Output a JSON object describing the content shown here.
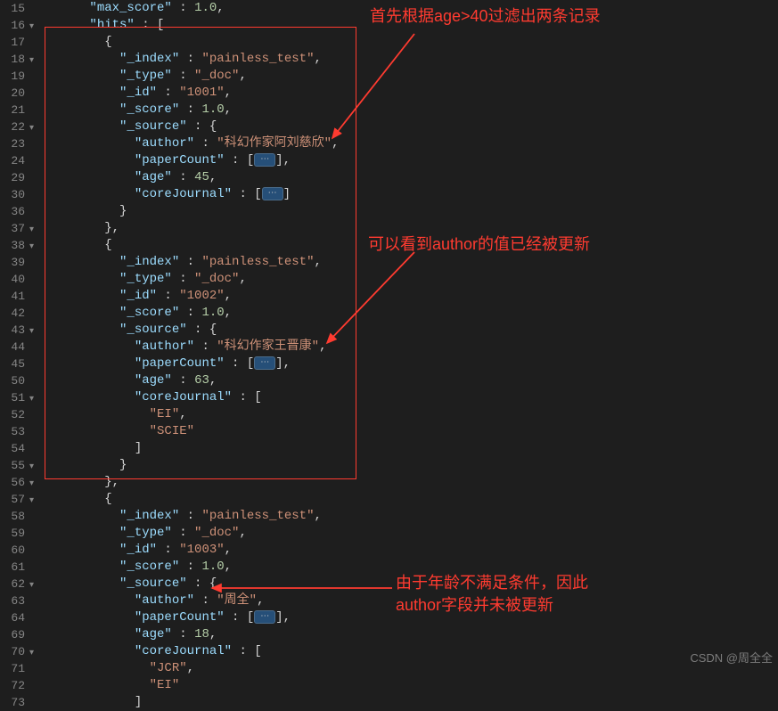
{
  "gutter": [
    "15",
    "16",
    "17",
    "18",
    "19",
    "20",
    "21",
    "22",
    "23",
    "24",
    "29",
    "30",
    "36",
    "37",
    "38",
    "39",
    "40",
    "41",
    "42",
    "43",
    "44",
    "45",
    "50",
    "51",
    "52",
    "53",
    "54",
    "55",
    "56",
    "57",
    "58",
    "59",
    "60",
    "61",
    "62",
    "63",
    "64",
    "69",
    "70",
    "71",
    "72",
    "73"
  ],
  "folds": [
    1,
    3,
    7,
    13,
    14,
    19,
    23,
    27,
    28,
    29,
    34,
    38
  ],
  "lines": {
    "l0": {
      "pre": "      ",
      "k": "\"max_score\"",
      "mid": " : ",
      "v": "1.0",
      "tail": ","
    },
    "l1": {
      "pre": "      ",
      "k": "\"hits\"",
      "mid": " : [",
      "v": "",
      "tail": ""
    },
    "l2": {
      "pre": "        {",
      "k": "",
      "mid": "",
      "v": "",
      "tail": ""
    },
    "l3": {
      "pre": "          ",
      "k": "\"_index\"",
      "mid": " : ",
      "v": "\"painless_test\"",
      "tail": ","
    },
    "l4": {
      "pre": "          ",
      "k": "\"_type\"",
      "mid": " : ",
      "v": "\"_doc\"",
      "tail": ","
    },
    "l5": {
      "pre": "          ",
      "k": "\"_id\"",
      "mid": " : ",
      "v": "\"1001\"",
      "tail": ","
    },
    "l6": {
      "pre": "          ",
      "k": "\"_score\"",
      "mid": " : ",
      "v": "1.0",
      "tail": ","
    },
    "l7": {
      "pre": "          ",
      "k": "\"_source\"",
      "mid": " : {",
      "v": "",
      "tail": ""
    },
    "l8": {
      "pre": "            ",
      "k": "\"author\"",
      "mid": " : ",
      "v": "\"科幻作家阿刘慈欣\"",
      "tail": ","
    },
    "l9": {
      "pre": "            ",
      "k": "\"paperCount\"",
      "mid": " : [",
      "v": "",
      "tail": "],",
      "badge": "⋯"
    },
    "l10": {
      "pre": "            ",
      "k": "\"age\"",
      "mid": " : ",
      "v": "45",
      "tail": ","
    },
    "l11": {
      "pre": "            ",
      "k": "\"coreJournal\"",
      "mid": " : [",
      "v": "",
      "tail": "]",
      "badge": "⋯"
    },
    "l12": {
      "pre": "          }",
      "k": "",
      "mid": "",
      "v": "",
      "tail": ""
    },
    "l13": {
      "pre": "        },",
      "k": "",
      "mid": "",
      "v": "",
      "tail": ""
    },
    "l14": {
      "pre": "        {",
      "k": "",
      "mid": "",
      "v": "",
      "tail": ""
    },
    "l15": {
      "pre": "          ",
      "k": "\"_index\"",
      "mid": " : ",
      "v": "\"painless_test\"",
      "tail": ","
    },
    "l16": {
      "pre": "          ",
      "k": "\"_type\"",
      "mid": " : ",
      "v": "\"_doc\"",
      "tail": ","
    },
    "l17": {
      "pre": "          ",
      "k": "\"_id\"",
      "mid": " : ",
      "v": "\"1002\"",
      "tail": ","
    },
    "l18": {
      "pre": "          ",
      "k": "\"_score\"",
      "mid": " : ",
      "v": "1.0",
      "tail": ","
    },
    "l19": {
      "pre": "          ",
      "k": "\"_source\"",
      "mid": " : {",
      "v": "",
      "tail": ""
    },
    "l20": {
      "pre": "            ",
      "k": "\"author\"",
      "mid": " : ",
      "v": "\"科幻作家王晋康\"",
      "tail": ","
    },
    "l21": {
      "pre": "            ",
      "k": "\"paperCount\"",
      "mid": " : [",
      "v": "",
      "tail": "],",
      "badge": "⋯"
    },
    "l22": {
      "pre": "            ",
      "k": "\"age\"",
      "mid": " : ",
      "v": "63",
      "tail": ","
    },
    "l23": {
      "pre": "            ",
      "k": "\"coreJournal\"",
      "mid": " : [",
      "v": "",
      "tail": ""
    },
    "l24": {
      "pre": "              ",
      "k": "",
      "mid": "",
      "v": "\"EI\"",
      "tail": ","
    },
    "l25": {
      "pre": "              ",
      "k": "",
      "mid": "",
      "v": "\"SCIE\"",
      "tail": ""
    },
    "l26": {
      "pre": "            ]",
      "k": "",
      "mid": "",
      "v": "",
      "tail": ""
    },
    "l27": {
      "pre": "          }",
      "k": "",
      "mid": "",
      "v": "",
      "tail": ""
    },
    "l28": {
      "pre": "        },",
      "k": "",
      "mid": "",
      "v": "",
      "tail": ""
    },
    "l29": {
      "pre": "        {",
      "k": "",
      "mid": "",
      "v": "",
      "tail": ""
    },
    "l30": {
      "pre": "          ",
      "k": "\"_index\"",
      "mid": " : ",
      "v": "\"painless_test\"",
      "tail": ","
    },
    "l31": {
      "pre": "          ",
      "k": "\"_type\"",
      "mid": " : ",
      "v": "\"_doc\"",
      "tail": ","
    },
    "l32": {
      "pre": "          ",
      "k": "\"_id\"",
      "mid": " : ",
      "v": "\"1003\"",
      "tail": ","
    },
    "l33": {
      "pre": "          ",
      "k": "\"_score\"",
      "mid": " : ",
      "v": "1.0",
      "tail": ","
    },
    "l34": {
      "pre": "          ",
      "k": "\"_source\"",
      "mid": " : {",
      "v": "",
      "tail": ""
    },
    "l35": {
      "pre": "            ",
      "k": "\"author\"",
      "mid": " : ",
      "v": "\"周全\"",
      "tail": ","
    },
    "l36": {
      "pre": "            ",
      "k": "\"paperCount\"",
      "mid": " : [",
      "v": "",
      "tail": "],",
      "badge": "⋯"
    },
    "l37": {
      "pre": "            ",
      "k": "\"age\"",
      "mid": " : ",
      "v": "18",
      "tail": ","
    },
    "l38": {
      "pre": "            ",
      "k": "\"coreJournal\"",
      "mid": " : [",
      "v": "",
      "tail": ""
    },
    "l39": {
      "pre": "              ",
      "k": "",
      "mid": "",
      "v": "\"JCR\"",
      "tail": ","
    },
    "l40": {
      "pre": "              ",
      "k": "",
      "mid": "",
      "v": "\"EI\"",
      "tail": ""
    },
    "l41": {
      "pre": "            ]",
      "k": "",
      "mid": "",
      "v": "",
      "tail": ""
    }
  },
  "annotations": {
    "a1": "首先根据age>40过滤出两条记录",
    "a2": "可以看到author的值已经被更新",
    "a3a": "由于年龄不满足条件，因此",
    "a3b": "author字段并未被更新"
  },
  "watermark": "CSDN @周全全"
}
